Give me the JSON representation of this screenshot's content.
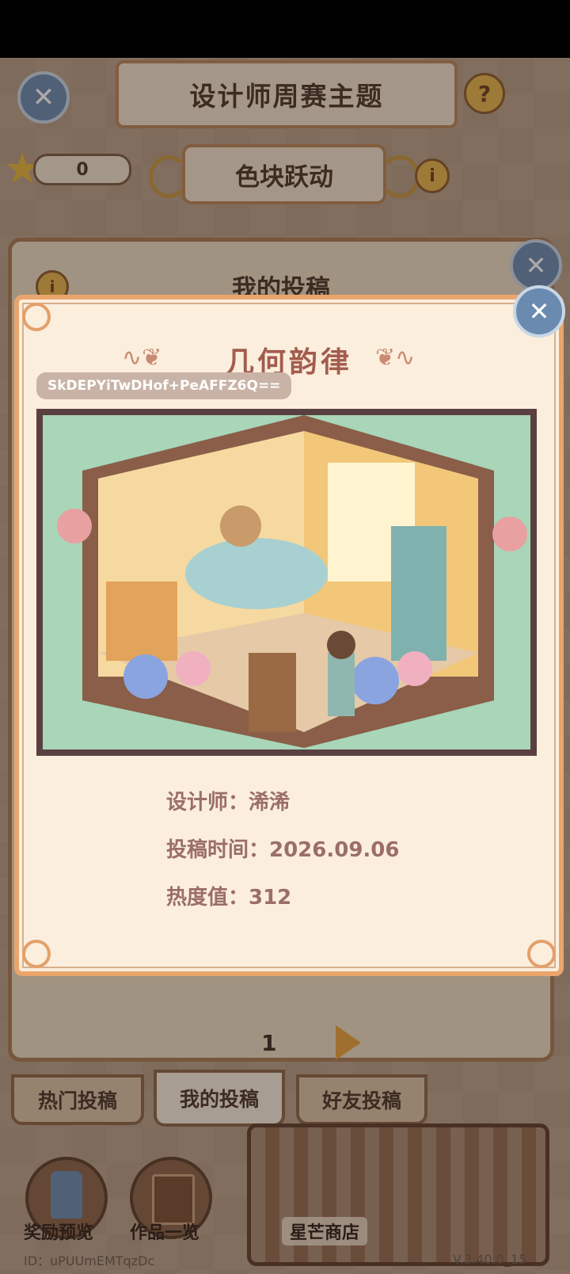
{
  "header": {
    "title": "设计师周赛主题",
    "score": "0",
    "theme": "色块跃动"
  },
  "background_panel": {
    "title": "我的投稿",
    "page": "1"
  },
  "tabs": [
    {
      "label": "热门投稿",
      "active": false
    },
    {
      "label": "我的投稿",
      "active": true
    },
    {
      "label": "好友投稿",
      "active": false
    }
  ],
  "bottom": {
    "reward_label": "奖励预览",
    "works_label": "作品一览",
    "shop_label": "星芒商店",
    "id_text": "ID：uPUUmEMTqzDc",
    "version_text": "V.3.40.0_15"
  },
  "modal": {
    "title": "几何韵律",
    "code": "SkDEPYiTwDHof+PeAFFZ6Q==",
    "designer": "设计师：浠浠",
    "submit_time": "投稿时间：2026.09.06",
    "heat": "热度值：312"
  },
  "colors": {
    "accent": "#e9a56c",
    "title_text": "#a35c4e",
    "detail_text": "#9b6e68"
  }
}
